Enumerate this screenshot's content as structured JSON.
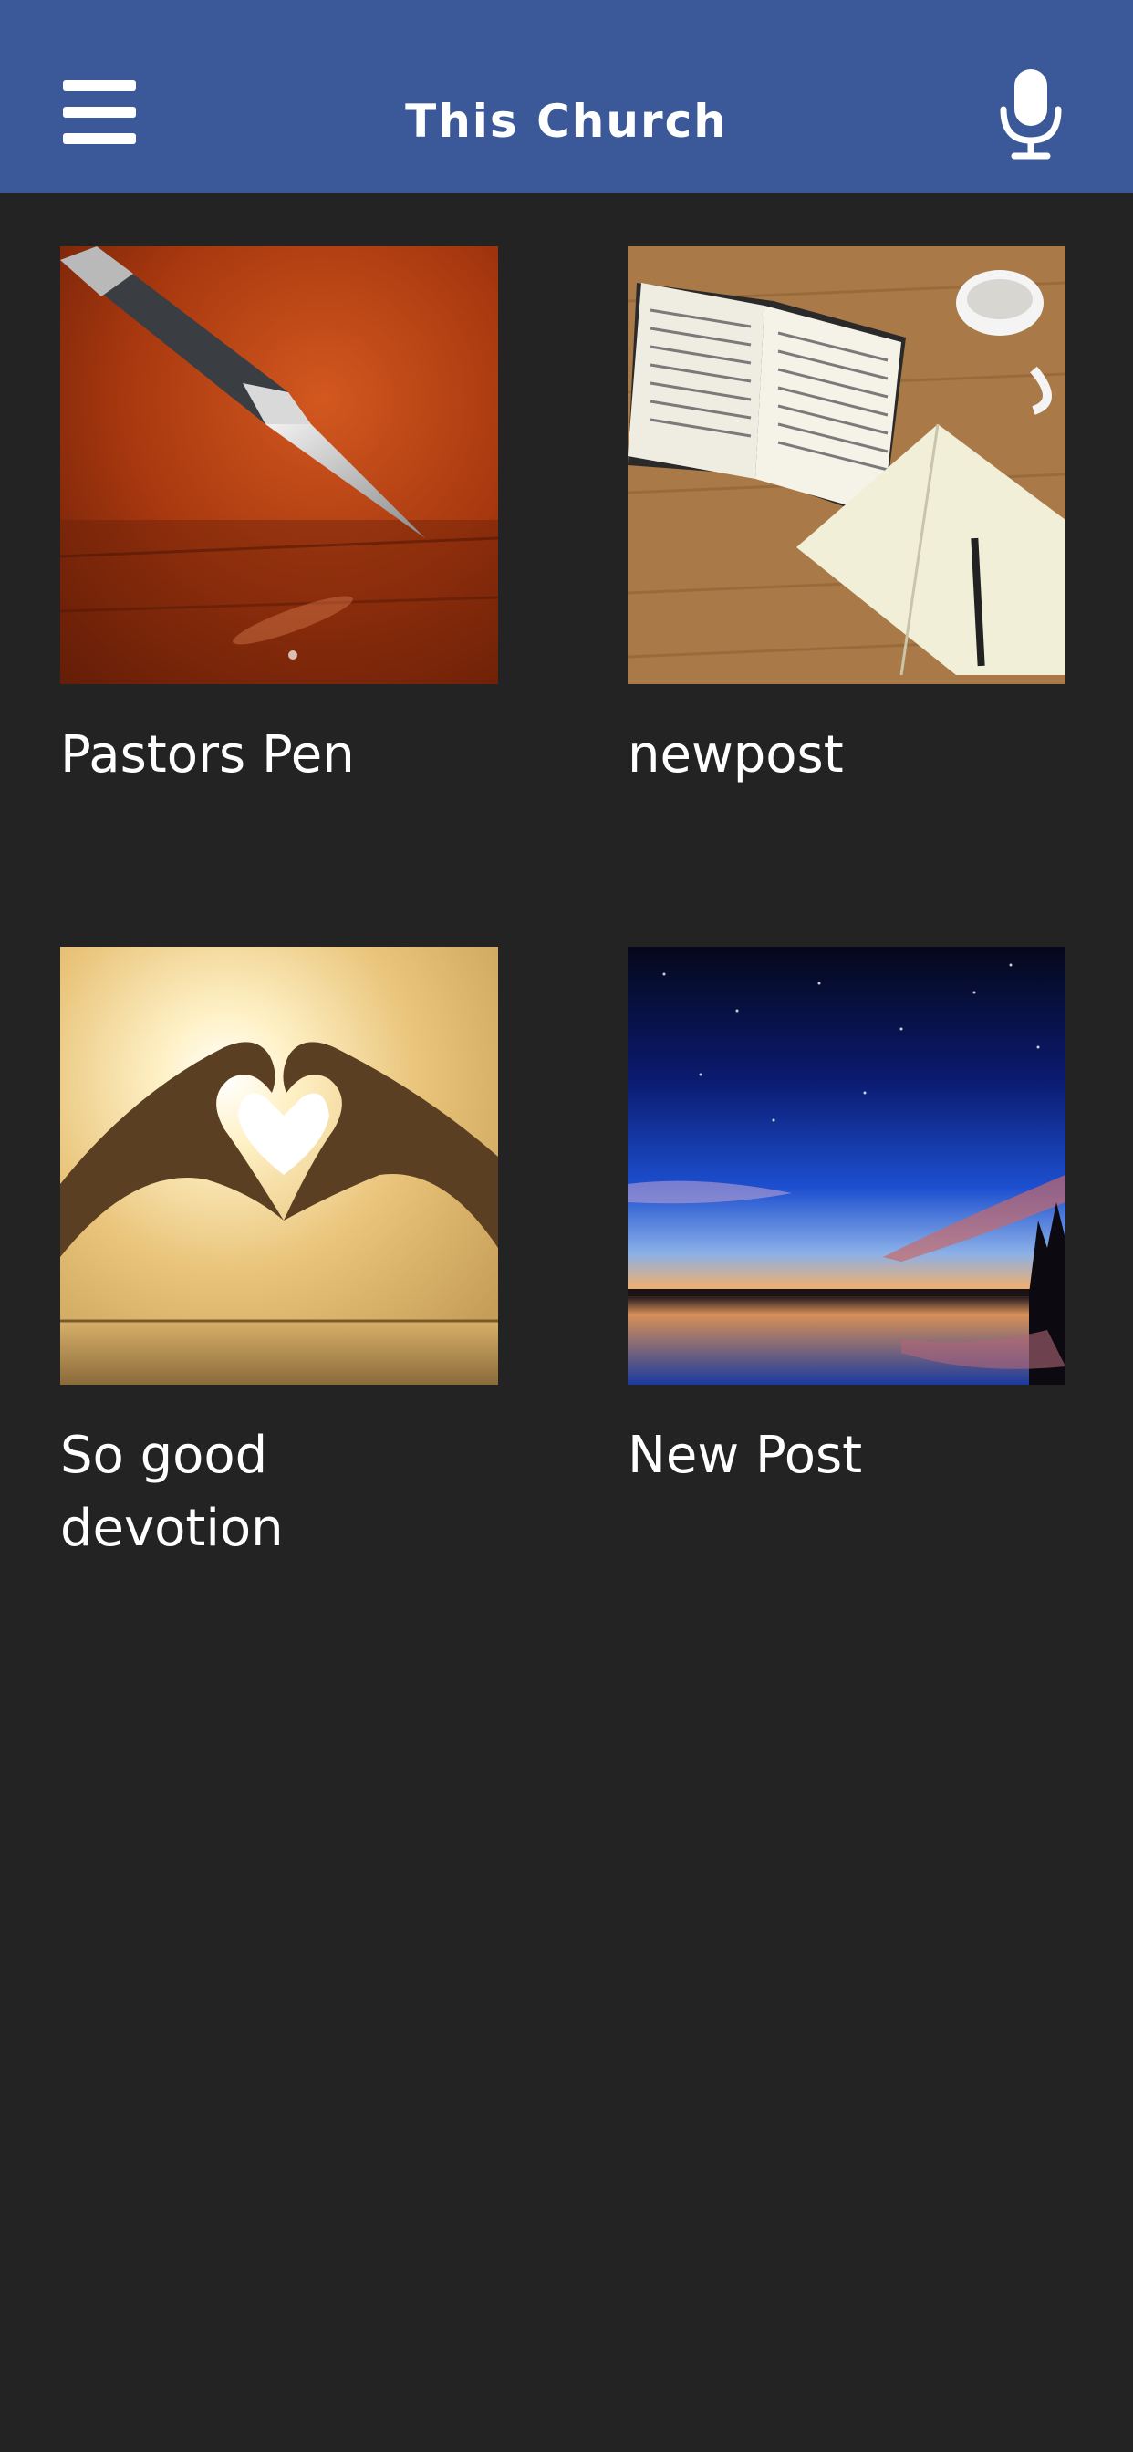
{
  "header": {
    "title": "This Church",
    "menu_icon": "hamburger-menu-icon",
    "mic_icon": "microphone-icon",
    "background_color": "#3b5998"
  },
  "background_color": "#232323",
  "posts": [
    {
      "title": "Pastors Pen",
      "image": "fountain-pen-image"
    },
    {
      "title": "newpost",
      "image": "open-bible-notebook-image"
    },
    {
      "title": "So good devotion",
      "image": "heart-hands-sunset-image"
    },
    {
      "title": "New Post",
      "image": "night-sky-lake-image"
    }
  ]
}
